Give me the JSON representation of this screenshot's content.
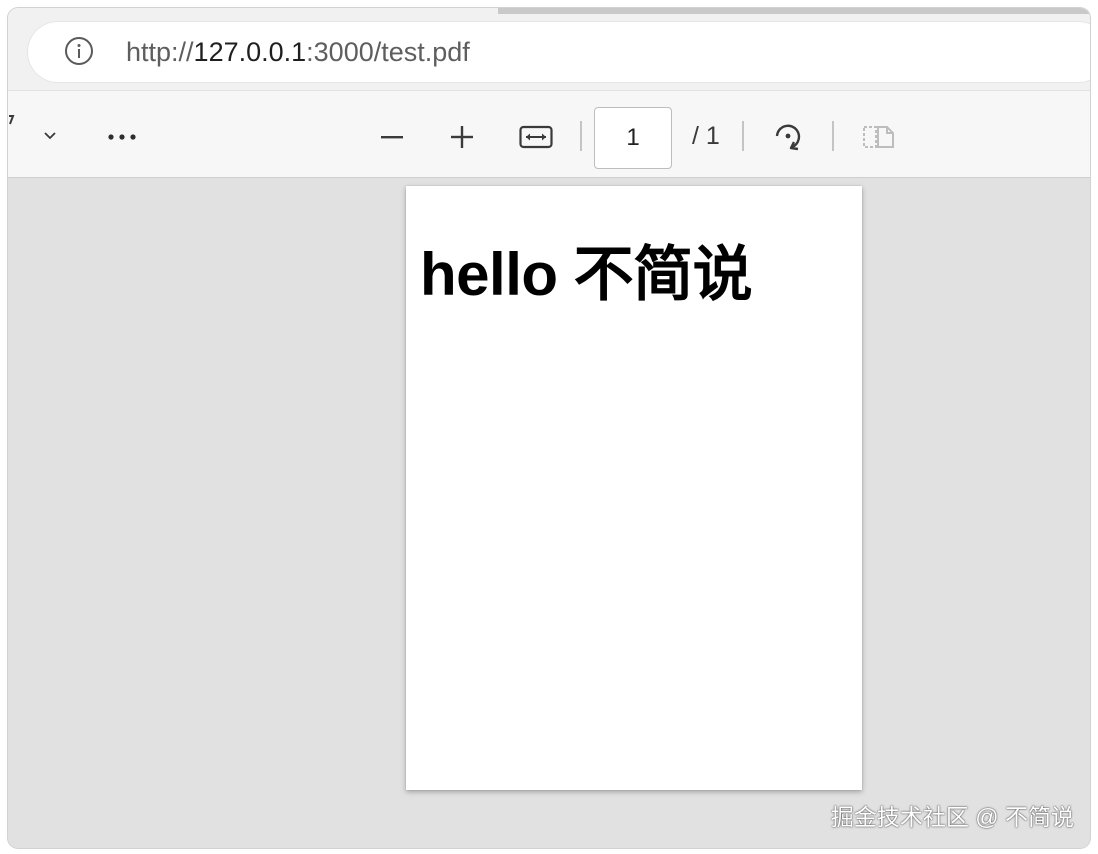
{
  "address_bar": {
    "url_scheme": "http://",
    "url_host": "127.0.0.1",
    "url_rest": ":3000/test.pdf"
  },
  "toolbar": {
    "page_current": "1",
    "page_total": "/ 1",
    "icons": [
      "chevron-down",
      "more",
      "zoom-out",
      "zoom-in",
      "fit-width",
      "rotate",
      "two-page"
    ]
  },
  "document": {
    "text": "hello 不简说"
  },
  "watermark": {
    "text": "掘金技术社区 @ 不简说"
  },
  "colors": {
    "viewer_background": "#e1e1e1",
    "toolbar_background": "#f7f7f7",
    "page_background": "#ffffff"
  }
}
